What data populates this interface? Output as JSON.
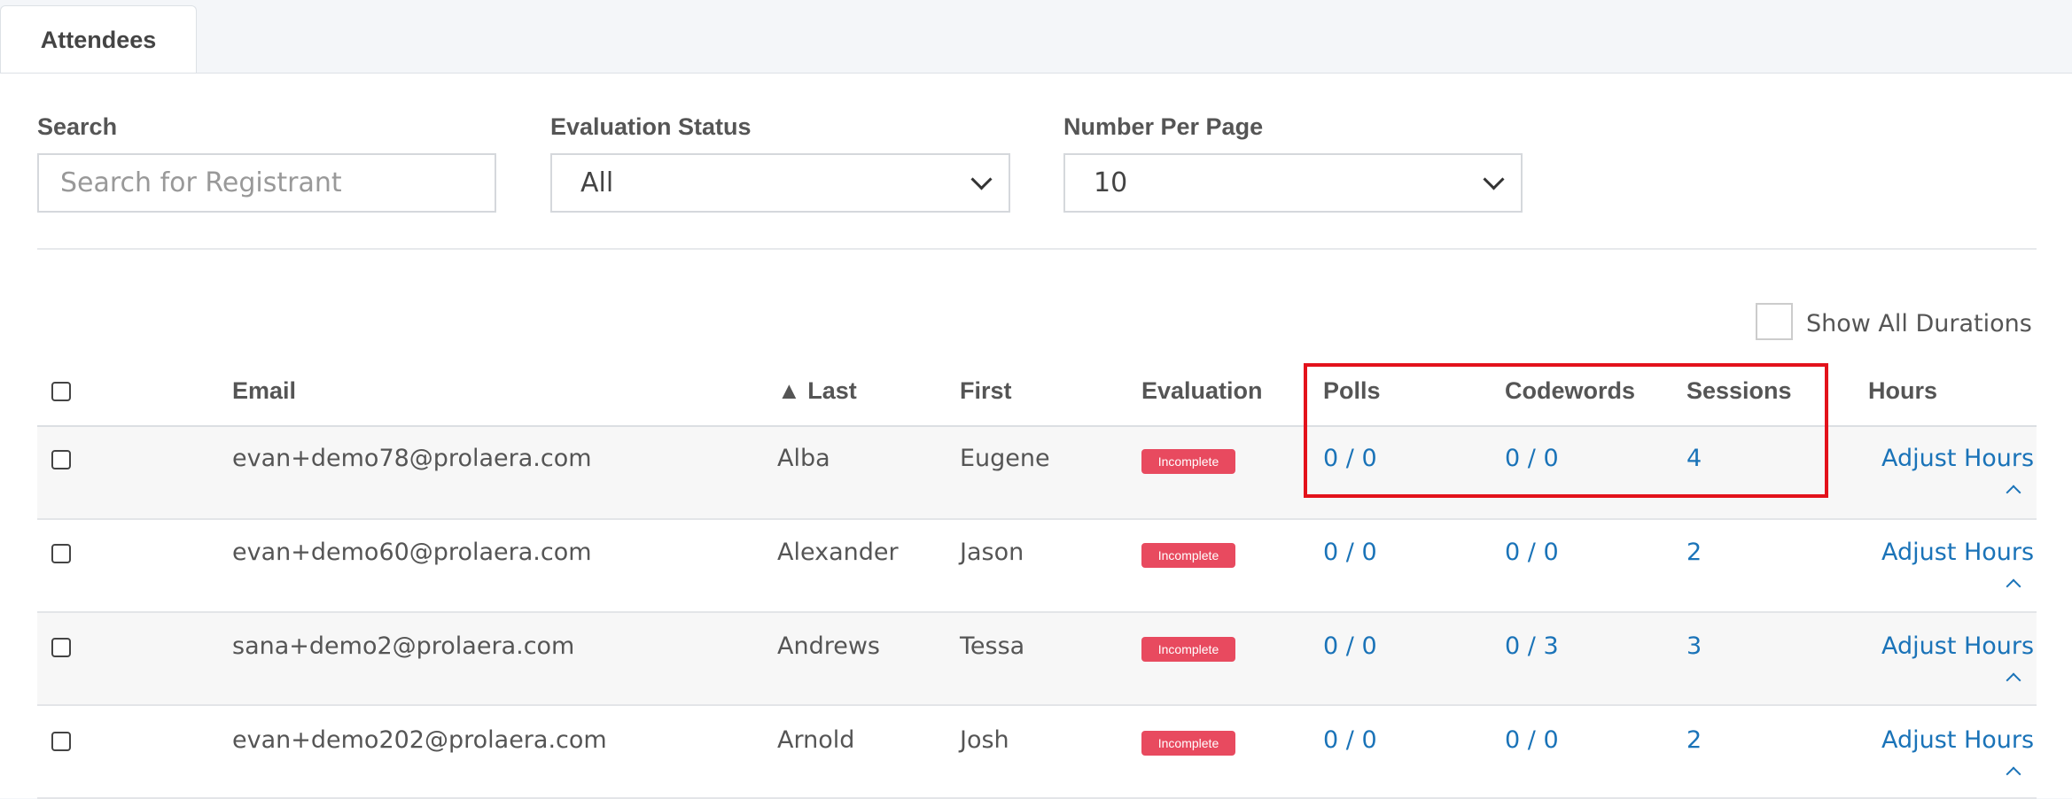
{
  "tab": {
    "label": "Attendees"
  },
  "filters": {
    "search_label": "Search",
    "search_placeholder": "Search for Registrant",
    "eval_label": "Evaluation Status",
    "eval_value": "All",
    "per_page_label": "Number Per Page",
    "per_page_value": "10"
  },
  "show_all_durations": "Show All Durations",
  "columns": {
    "email": "Email",
    "last": "▲ Last",
    "first": "First",
    "evaluation": "Evaluation",
    "polls": "Polls",
    "codewords": "Codewords",
    "sessions": "Sessions",
    "hours": "Hours"
  },
  "rows": [
    {
      "email": "evan+demo78@prolaera.com",
      "last": "Alba",
      "first": "Eugene",
      "evaluation": "Incomplete",
      "polls": "0 / 0",
      "codewords": "0 / 0",
      "sessions": "4",
      "hours": "Adjust Hours"
    },
    {
      "email": "evan+demo60@prolaera.com",
      "last": "Alexander",
      "first": "Jason",
      "evaluation": "Incomplete",
      "polls": "0 / 0",
      "codewords": "0 / 0",
      "sessions": "2",
      "hours": "Adjust Hours"
    },
    {
      "email": "sana+demo2@prolaera.com",
      "last": "Andrews",
      "first": "Tessa",
      "evaluation": "Incomplete",
      "polls": "0 / 0",
      "codewords": "0 / 3",
      "sessions": "3",
      "hours": "Adjust Hours"
    },
    {
      "email": "evan+demo202@prolaera.com",
      "last": "Arnold",
      "first": "Josh",
      "evaluation": "Incomplete",
      "polls": "0 / 0",
      "codewords": "0 / 0",
      "sessions": "2",
      "hours": "Adjust Hours"
    }
  ],
  "colors": {
    "link": "#1a73b8",
    "badge": "#e84a5f",
    "highlight": "#e3121b"
  }
}
